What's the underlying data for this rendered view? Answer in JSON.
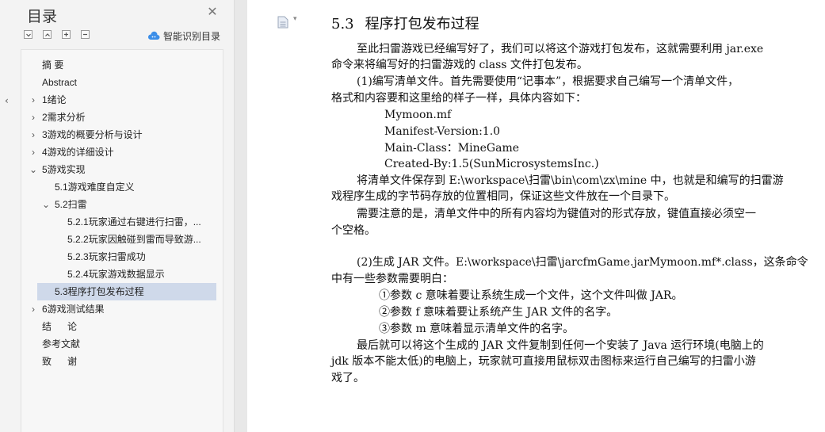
{
  "sidebar": {
    "title": "目录",
    "smart_label": "智能识别目录",
    "items": [
      {
        "label": "摘  要"
      },
      {
        "label": "Abstract"
      },
      {
        "label": "1绪论"
      },
      {
        "label": "2需求分析"
      },
      {
        "label": "3游戏的概要分析与设计"
      },
      {
        "label": "4游戏的详细设计"
      },
      {
        "label": "5游戏实现"
      },
      {
        "label": "5.1游戏难度自定义"
      },
      {
        "label": "5.2扫雷"
      },
      {
        "label": "5.2.1玩家通过右键进行扫雷，..."
      },
      {
        "label": "5.2.2玩家因触碰到雷而导致游..."
      },
      {
        "label": "5.2.3玩家扫雷成功"
      },
      {
        "label": "5.2.4玩家游戏数据显示"
      },
      {
        "label": "5.3程序打包发布过程"
      },
      {
        "label": "6游戏测试结果"
      },
      {
        "label": "结      论"
      },
      {
        "label": "参考文献"
      },
      {
        "label": "致      谢"
      }
    ]
  },
  "doc": {
    "heading_num": "5.3",
    "heading_text": "程序打包发布过程",
    "lines": [
      "至此扫雷游戏已经编写好了，我们可以将这个游戏打包发布，这就需要利用 jar.exe",
      "命令来将编写好的扫雷游戏的 class 文件打包发布。",
      "(1)编写清单文件。首先需要使用“记事本”，根据要求自己编写一个清单文件，",
      "格式和内容要和这里给的样子一样，具体内容如下：",
      "Mymoon.mf",
      "Manifest-Version:1.0",
      "Main-Class：MineGame",
      "Created-By:1.5(SunMicrosystemsInc.)",
      "将清单文件保存到 E:\\workspace\\扫雷\\bin\\com\\zx\\mine 中，也就是和编写的扫雷游",
      "戏程序生成的字节码存放的位置相同，保证这些文件放在一个目录下。",
      "需要注意的是，清单文件中的所有内容均为键值对的形式存放，键值直接必须空一",
      "个空格。",
      "(2)生成 JAR 文件。E:\\workspace\\扫雷\\jarcfmGame.jarMymoon.mf*.class，这条命令",
      "中有一些参数需要明白：",
      "①参数 c 意味着要让系统生成一个文件，这个文件叫做 JAR。",
      "②参数 f 意味着要让系统产生 JAR 文件的名字。",
      "③参数 m 意味着显示清单文件的名字。",
      "最后就可以将这个生成的 JAR 文件复制到任何一个安装了 Java 运行环境(电脑上的",
      "jdk 版本不能太低)的电脑上，玩家就可直接用鼠标双击图标来运行自己编写的扫雷小游",
      "戏了。"
    ]
  }
}
